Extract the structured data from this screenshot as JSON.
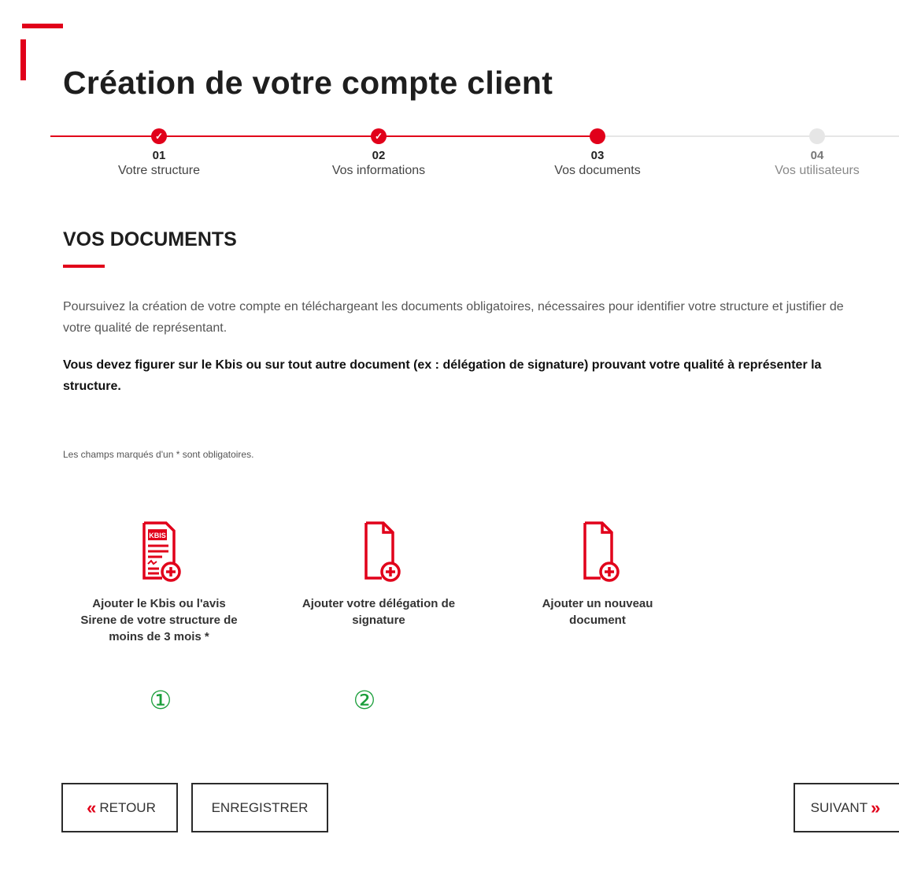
{
  "page": {
    "title": "Création de votre compte client"
  },
  "stepper": {
    "steps": [
      {
        "number": "01",
        "label": "Votre structure",
        "state": "done"
      },
      {
        "number": "02",
        "label": "Vos informations",
        "state": "done"
      },
      {
        "number": "03",
        "label": "Vos documents",
        "state": "current"
      },
      {
        "number": "04",
        "label": "Vos utilisateurs",
        "state": "todo"
      }
    ],
    "done_icon": "check-icon"
  },
  "section": {
    "title": "VOS DOCUMENTS",
    "intro": "Poursuivez la création de votre compte en téléchargeant les documents obligatoires, nécessaires pour identifier votre structure et justifier de votre qualité de représentant.",
    "notice": "Vous devez figurer sur le Kbis ou sur tout autre document (ex : délégation de signature) prouvant votre qualité à représenter la structure.",
    "required_note": "Les champs marqués d'un * sont obligatoires."
  },
  "uploads": [
    {
      "label": "Ajouter le Kbis ou l'avis Sirene de votre structure de moins de 3 mois *",
      "icon": "kbis-document-add-icon",
      "icon_text": "KBIS"
    },
    {
      "label": "Ajouter votre délégation de signature",
      "icon": "document-add-icon"
    },
    {
      "label": "Ajouter un nouveau document",
      "icon": "document-add-icon"
    }
  ],
  "markers": [
    "①",
    "②"
  ],
  "buttons": {
    "back": "RETOUR",
    "save": "ENREGISTRER",
    "next": "SUIVANT"
  },
  "colors": {
    "accent": "#e1001a",
    "marker": "#1a9e3a",
    "inactive": "#e6e6e6"
  }
}
